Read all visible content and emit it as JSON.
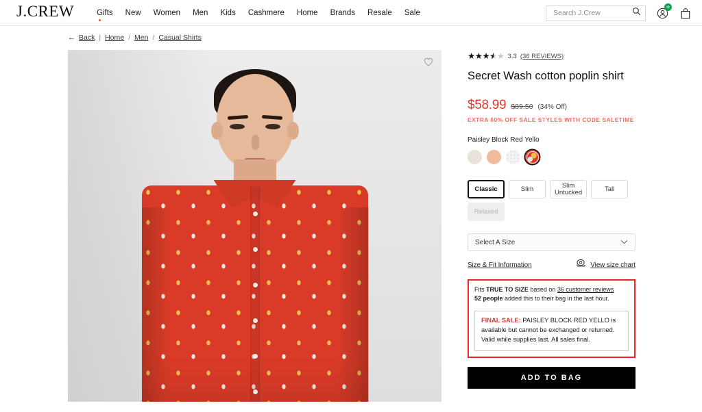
{
  "header": {
    "logo": "J.CREW",
    "nav": [
      {
        "label": "Gifts",
        "dot": true
      },
      {
        "label": "New",
        "dot": false
      },
      {
        "label": "Women",
        "dot": false
      },
      {
        "label": "Men",
        "dot": false
      },
      {
        "label": "Kids",
        "dot": false
      },
      {
        "label": "Cashmere",
        "dot": false
      },
      {
        "label": "Home",
        "dot": false
      },
      {
        "label": "Brands",
        "dot": false
      },
      {
        "label": "Resale",
        "dot": false
      },
      {
        "label": "Sale",
        "dot": false
      }
    ],
    "search_placeholder": "Search J.Crew",
    "search_value": "",
    "account_badge": "+"
  },
  "breadcrumb": {
    "back": "Back",
    "items": [
      "Home",
      "Men",
      "Casual Shirts"
    ],
    "separator": "/"
  },
  "gallery": {
    "alt": "Model wearing red paisley print button-down shirt",
    "wishlist": "heart-icon"
  },
  "product": {
    "rating_value": "3.3",
    "rating_stars": 3.3,
    "reviews_link": "(36 REVIEWS)",
    "title": "Secret Wash cotton poplin shirt",
    "price_current": "$58.99",
    "price_original": "$89.50",
    "discount": "(34% Off)",
    "promo": "EXTRA 60% OFF SALE STYLES WITH CODE SALETIME",
    "color_name": "Paisley Block Red Yello",
    "swatches": [
      {
        "name": "cream",
        "color": "#e8e2d8",
        "selected": false
      },
      {
        "name": "peach",
        "color": "#f2bb9b",
        "selected": false
      },
      {
        "name": "white-dot",
        "color": "#f4f4f4",
        "selected": false
      },
      {
        "name": "paisley-block-red-yello",
        "color": "#d93b28",
        "selected": true
      }
    ],
    "fits": [
      {
        "label": "Classic",
        "selected": true,
        "disabled": false
      },
      {
        "label": "Slim",
        "selected": false,
        "disabled": false
      },
      {
        "label": "Slim\nUntucked",
        "selected": false,
        "disabled": false
      },
      {
        "label": "Tall",
        "selected": false,
        "disabled": false
      },
      {
        "label": "Relaxed",
        "selected": false,
        "disabled": true
      }
    ],
    "size_placeholder": "Select A Size",
    "size_fit_link": "Size & Fit Information",
    "size_chart_link": "View size chart",
    "fit_note_prefix": "Fits ",
    "fit_note_bold": "TRUE TO SIZE",
    "fit_note_mid": " based on ",
    "fit_note_link": "36 customer reviews",
    "urgency_count": "52 people",
    "urgency_text": " added this to their bag in the last hour.",
    "final_sale_label": "FINAL SALE:",
    "final_sale_text": " PAISLEY BLOCK RED YELLO is available but cannot be exchanged or returned. Valid while supplies last. All sales final.",
    "add_to_bag": "ADD TO BAG"
  },
  "colors": {
    "sale_red": "#e03a2f",
    "promo_red": "#ee6b61",
    "alert_border": "#f42222",
    "badge_green": "#00a94f",
    "button_black": "#000000"
  }
}
